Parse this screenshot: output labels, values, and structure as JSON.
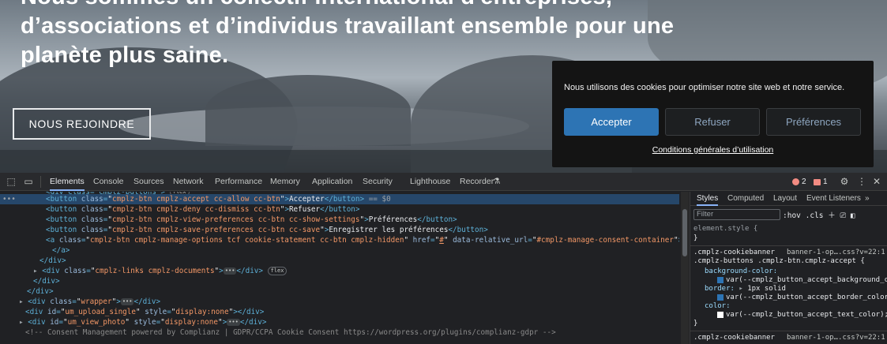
{
  "site": {
    "hero_title": "Nous sommes un collectif international d'entreprises, d’associations et d’individus travaillant ensemble pour une planète plus saine.",
    "join_button": "NOUS REJOINDRE"
  },
  "cookie_banner": {
    "message": "Nous utilisons des cookies pour optimiser notre site web et notre service.",
    "accept": "Accepter",
    "deny": "Refuser",
    "preferences": "Préférences",
    "terms_link": "Conditions générales d’utilisation"
  },
  "devtools": {
    "tabs": [
      "Elements",
      "Console",
      "Sources",
      "Network",
      "Performance",
      "Memory",
      "Application",
      "Security",
      "Lighthouse",
      "Recorder"
    ],
    "active_tab": "Elements",
    "error_count": "2",
    "issue_count": "1",
    "colors": {
      "accent": "#8ab4f8",
      "selection": "#26476a",
      "tag": "#5db0d7",
      "attr_value": "#f29766"
    },
    "dom_lines": [
      {
        "id": "l1",
        "text": "<button class=\"cmplz-btn cmplz-accept cc-allow cc-btn\">Accepter</button> == $0"
      },
      {
        "id": "l2",
        "text": "<button class=\"cmplz-btn cmplz-deny cc-dismiss cc-btn\">Refuser</button>"
      },
      {
        "id": "l3",
        "text": "<button class=\"cmplz-btn cmplz-view-preferences cc-btn cc-show-settings\">Préférences</button>"
      },
      {
        "id": "l4",
        "text": "<button class=\"cmplz-btn cmplz-save-preferences cc-btn cc-save\">Enregistrer les préférences</button>"
      },
      {
        "id": "l5",
        "text": "<a class=\"cmplz-btn cmplz-manage-options tcf cookie-statement cc-btn cmplz-hidden\" href=\"#\" data-relative_url=\"#cmplz-manage-consent-container\">Préférences"
      },
      {
        "id": "l6",
        "text": "</a>"
      },
      {
        "id": "l7",
        "text": "</div>"
      },
      {
        "id": "l8",
        "text": "<div class=\"cmplz-links cmplz-documents\">…</div>"
      },
      {
        "id": "l9",
        "text": "</div>"
      },
      {
        "id": "l10",
        "text": "</div>"
      },
      {
        "id": "l11",
        "text": "<div class=\"wrapper\">…</div>"
      },
      {
        "id": "l12",
        "text": "<div id=\"um_upload_single\" style=\"display:none\"></div>"
      },
      {
        "id": "l13",
        "text": "<div id=\"um_view_photo\" style=\"display:none\">…</div>"
      },
      {
        "id": "l14",
        "text": "<!-- Consent Management powered by Complianz | GDPR/CCPA Cookie Consent https://wordpress.org/plugins/complianz-gdpr -->"
      }
    ],
    "flex_badge": "flex",
    "styles_panel": {
      "tabs": [
        "Styles",
        "Computed",
        "Layout",
        "Event Listeners"
      ],
      "active_tab": "Styles",
      "filter_placeholder": "Filter",
      "hov": ":hov",
      "cls": ".cls",
      "element_style": "element.style {",
      "close_brace": "}",
      "rule1_selector": ".cmplz-cookiebanner",
      "rule1_selector2": ".cmplz-buttons .cmplz-btn.cmplz-accept {",
      "rule1_source": "banner-1-op….css?v=22:1",
      "bg_prop": "background-color:",
      "bg_value": "var(--cmplz_button_accept_background_color)",
      "border_prop": "border:",
      "border_value": "1px solid",
      "border_color_value": "var(--cmplz_button_accept_border_color)",
      "color_prop": "color:",
      "color_value": "var(--cmplz_button_accept_text_color);",
      "rule2_selector": ".cmplz-cookiebanner",
      "rule2_source": "banner-1-op….css?v=22:1"
    }
  }
}
